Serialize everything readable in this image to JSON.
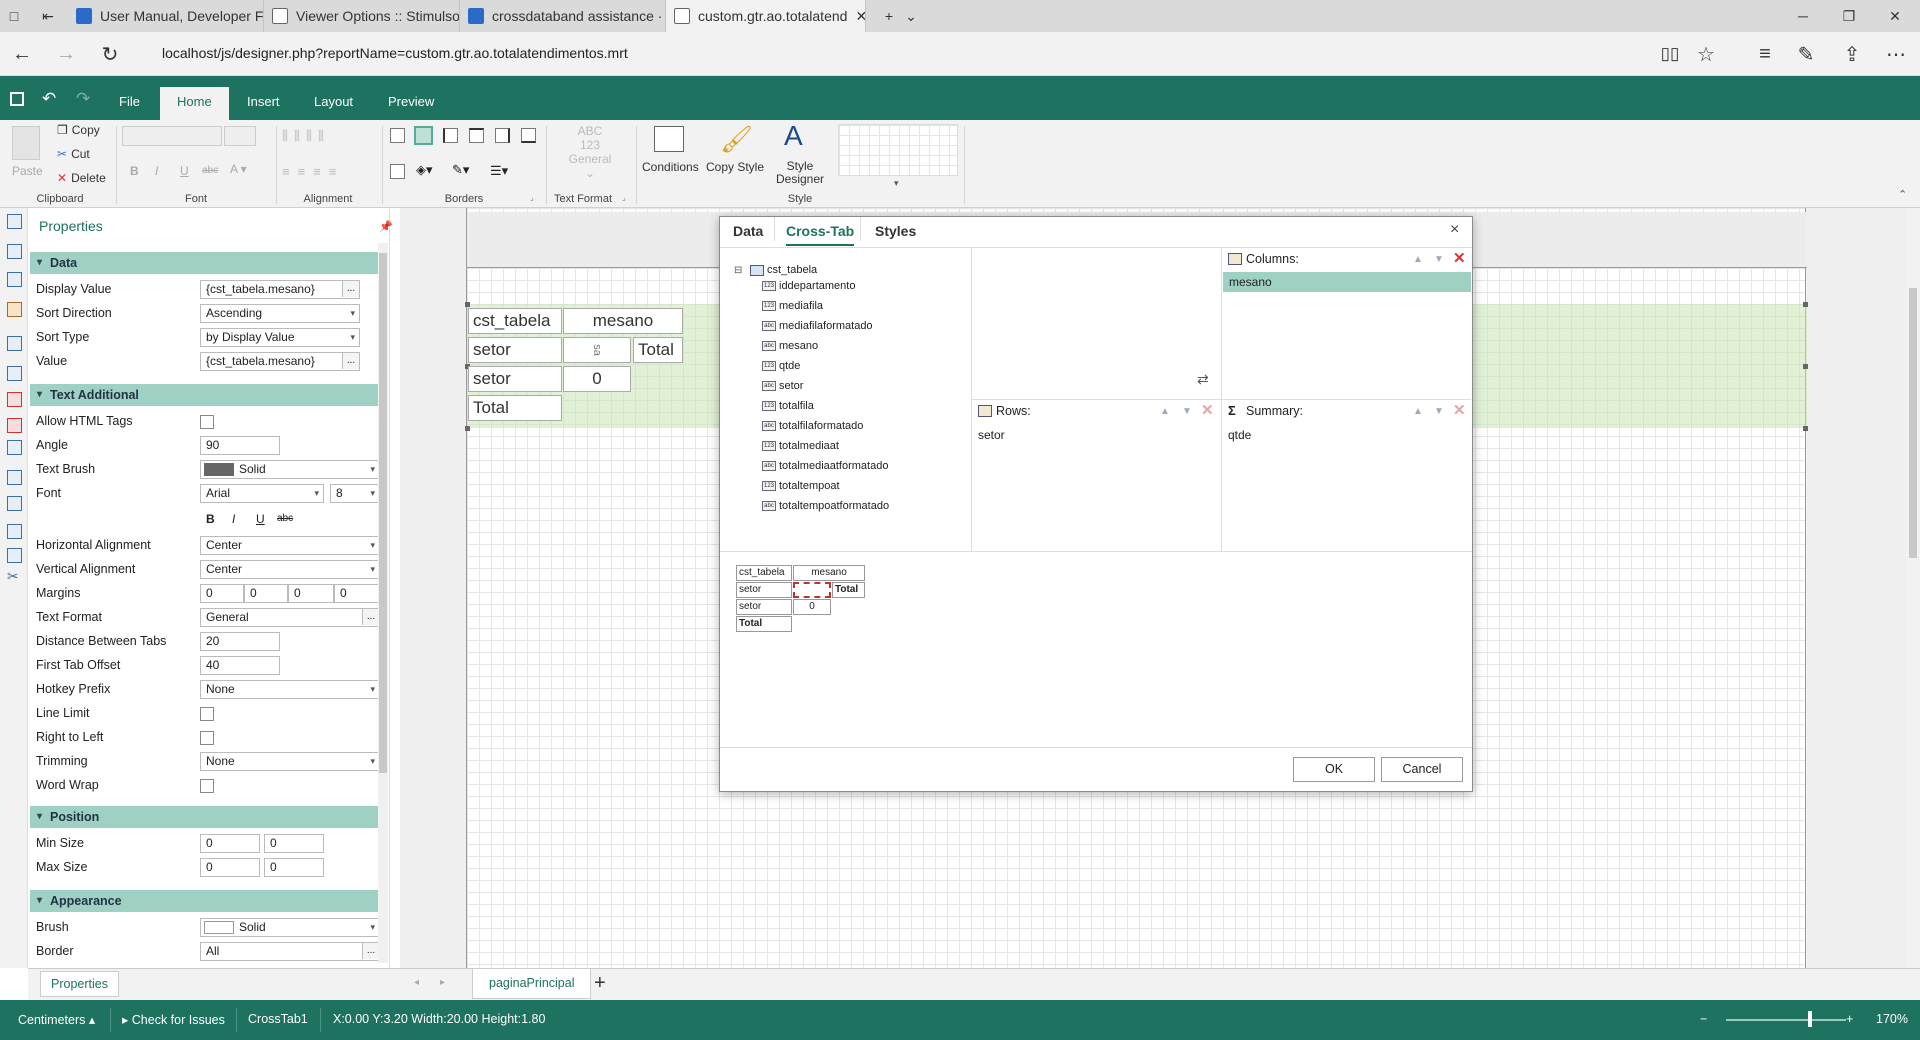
{
  "browser": {
    "tabs": [
      {
        "label": "User Manual, Developer FAQ",
        "active": false
      },
      {
        "label": "Viewer Options :: Stimulsoft",
        "active": false
      },
      {
        "label": "crossdataband assistance ·",
        "active": false
      },
      {
        "label": "custom.gtr.ao.totalatend",
        "active": true
      }
    ],
    "url": "localhost/js/designer.php?reportName=custom.gtr.ao.totalatendimentos.mrt"
  },
  "ribbon": {
    "tabs": [
      "File",
      "Home",
      "Insert",
      "Layout",
      "Preview"
    ],
    "active_tab": "Home",
    "clipboard": {
      "paste": "Paste",
      "copy": "Copy",
      "cut": "Cut",
      "delete": "Delete",
      "label": "Clipboard"
    },
    "groups": {
      "font": "Font",
      "alignment": "Alignment",
      "borders": "Borders",
      "text_format": "Text Format",
      "style": "Style"
    },
    "text_format_btn": {
      "abc": "ABC",
      "num": "123",
      "label": "General"
    },
    "conditions": "Conditions",
    "copy_style": "Copy Style",
    "style_designer_1": "Style",
    "style_designer_2": "Designer"
  },
  "properties": {
    "title": "Properties",
    "sections": {
      "data": "Data",
      "text_additional": "Text Additional",
      "position": "Position",
      "appearance": "Appearance"
    },
    "data": [
      {
        "label": "Display Value",
        "value": "{cst_tabela.mesano}"
      },
      {
        "label": "Sort Direction",
        "value": "Ascending"
      },
      {
        "label": "Sort Type",
        "value": "by Display Value"
      },
      {
        "label": "Value",
        "value": "{cst_tabela.mesano}"
      }
    ],
    "text_additional": {
      "allow_html": "Allow HTML Tags",
      "angle_label": "Angle",
      "angle": "90",
      "text_brush_label": "Text Brush",
      "text_brush": "Solid",
      "font_label": "Font",
      "font": "Arial",
      "font_size": "8",
      "font_styles": {
        "bold": "B",
        "italic": "I",
        "underline": "U",
        "strike": "abc"
      },
      "h_align_label": "Horizontal Alignment",
      "h_align": "Center",
      "v_align_label": "Vertical Alignment",
      "v_align": "Center",
      "margins_label": "Margins",
      "margins": [
        "0",
        "0",
        "0",
        "0"
      ],
      "text_format_label": "Text Format",
      "text_format": "General",
      "dist_tabs_label": "Distance Between Tabs",
      "dist_tabs": "20",
      "first_tab_label": "First Tab Offset",
      "first_tab": "40",
      "hotkey_label": "Hotkey Prefix",
      "hotkey": "None",
      "line_limit": "Line Limit",
      "rtl": "Right to Left",
      "trimming_label": "Trimming",
      "trimming": "None",
      "word_wrap": "Word Wrap"
    },
    "position": {
      "min_label": "Min Size",
      "min": [
        "0",
        "0"
      ],
      "max_label": "Max Size",
      "max": [
        "0",
        "0"
      ]
    },
    "appearance": {
      "brush_label": "Brush",
      "brush": "Solid",
      "border_label": "Border",
      "border": "All"
    },
    "footer_tab": "Properties"
  },
  "crosstab_canvas": {
    "cells": {
      "corner": "cst_tabela",
      "col_header": "mesano",
      "row1": "setor",
      "rotated": "sa",
      "total_col": "Total",
      "row2": "setor",
      "value": "0",
      "total_row": "Total"
    }
  },
  "dialog": {
    "tabs": [
      "Data",
      "Cross-Tab",
      "Styles"
    ],
    "active_tab": "Cross-Tab",
    "close": "×",
    "datasource": "cst_tabela",
    "fields": [
      {
        "name": "iddepartamento",
        "type": "123"
      },
      {
        "name": "mediafila",
        "type": "123"
      },
      {
        "name": "mediafilaformatado",
        "type": "abc"
      },
      {
        "name": "mesano",
        "type": "abc"
      },
      {
        "name": "qtde",
        "type": "123"
      },
      {
        "name": "setor",
        "type": "abc"
      },
      {
        "name": "totalfila",
        "type": "123"
      },
      {
        "name": "totalfilaformatado",
        "type": "abc"
      },
      {
        "name": "totalmediaat",
        "type": "123"
      },
      {
        "name": "totalmediaatformatado",
        "type": "abc"
      },
      {
        "name": "totaltempoat",
        "type": "123"
      },
      {
        "name": "totaltempoatformatado",
        "type": "abc"
      }
    ],
    "columns_label": "Columns:",
    "columns_value": "mesano",
    "rows_label": "Rows:",
    "rows_value": "setor",
    "summary_label": "Summary:",
    "summary_value": "qtde",
    "preview": {
      "corner": "cst_tabela",
      "col": "mesano",
      "row1": "setor",
      "total_col": "Total",
      "row2": "setor",
      "value": "0",
      "total_row": "Total"
    },
    "ok": "OK",
    "cancel": "Cancel"
  },
  "page_tab": "paginaPrincipal",
  "status": {
    "units": "Centimeters",
    "check": "Check for Issues",
    "component": "CrossTab1",
    "coords": "X:0.00 Y:3.20 Width:20.00 Height:1.80",
    "zoom": "170%"
  },
  "colors": {
    "accent": "#1e7260",
    "section": "#9fd0c4",
    "band": "#d7ecc8"
  }
}
